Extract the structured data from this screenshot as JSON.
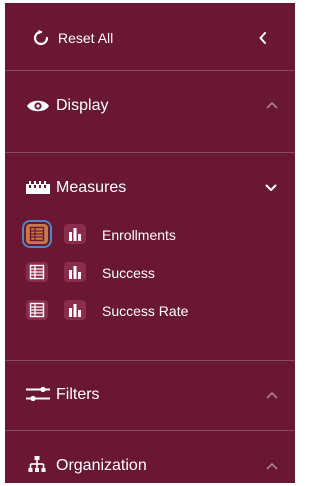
{
  "reset": {
    "label": "Reset All",
    "icon": "refresh-icon",
    "collapse_icon": "chevron-left-icon"
  },
  "sections": [
    {
      "label": "Display",
      "icon": "eye-icon",
      "state_icon": "chevron-up-icon"
    },
    {
      "label": "Measures",
      "icon": "ruler-icon",
      "state_icon": "chevron-down-icon"
    },
    {
      "label": "Filters",
      "icon": "sliders-icon",
      "state_icon": "chevron-up-icon"
    },
    {
      "label": "Organization",
      "icon": "hierarchy-icon",
      "state_icon": "chevron-up-icon"
    }
  ],
  "measures": [
    {
      "label": "Enrollments",
      "table_icon_active": true
    },
    {
      "label": "Success",
      "table_icon_active": false
    },
    {
      "label": "Success Rate",
      "table_icon_active": false
    }
  ],
  "colors": {
    "panel_background": "#6a1734",
    "icon_tile": "#8a2c4b",
    "active_tile": "#c77a46",
    "focus_ring": "#4e88c3",
    "text": "#ffffff"
  }
}
